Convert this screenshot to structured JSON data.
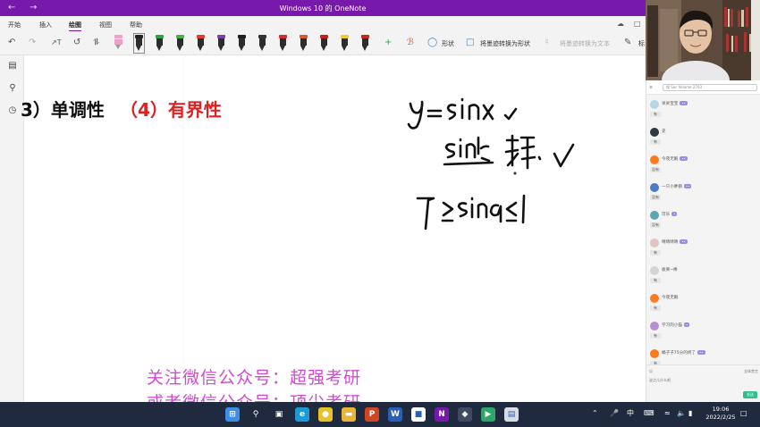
{
  "window": {
    "title": "Windows 10 的 OneNote",
    "back_icon": "back-arrow-icon",
    "forward_icon": "forward-arrow-icon"
  },
  "ribbon": {
    "tabs": [
      {
        "label": "开始",
        "active": false
      },
      {
        "label": "插入",
        "active": false
      },
      {
        "label": "绘图",
        "active": true
      },
      {
        "label": "视图",
        "active": false
      },
      {
        "label": "帮助",
        "active": false
      }
    ]
  },
  "toolbar": {
    "shapes_label": "形状",
    "ink_to_shape_label": "将墨迹转换为形状",
    "ink_to_text_label": "将墨迹转换为文本",
    "ruler_label": "标",
    "pen_colors": [
      "#f0a0c8",
      "#222222",
      "#2fa14b",
      "#47b347",
      "#e03b2f",
      "#7d3fb0",
      "#1f1f1f",
      "#333333",
      "#d42f2f",
      "#e0572e",
      "#c82020",
      "#eecf1e",
      "#c42525"
    ]
  },
  "note": {
    "heading_part1": "3）单调性",
    "heading_part2": "（4）有界性",
    "heading_color": "#e02020",
    "watermark_line1": "关注微信公众号：超强考研",
    "watermark_line2": "或者微信公众号：顶尖考研"
  },
  "chat": {
    "search_text": "搜 Soc Volume 2703",
    "messages": [
      {
        "name": "呆呆宝宝",
        "badge": "••",
        "tag": "有",
        "color": "#b6d6e8"
      },
      {
        "name": "史",
        "badge": "",
        "tag": "有",
        "color": "#2f3c3f"
      },
      {
        "name": "今夜无眠",
        "badge": "••",
        "tag": "没有",
        "color": "#ff7a1e"
      },
      {
        "name": "一只小胖鹅",
        "badge": "••",
        "tag": "没有",
        "color": "#4b7bc8"
      },
      {
        "name": "可乐",
        "badge": "•",
        "tag": "没有",
        "color": "#5aa8b4"
      },
      {
        "name": "晴晴晴晴",
        "badge": "••",
        "tag": "有",
        "color": "#e2c4c0"
      },
      {
        "name": "板栗~棒",
        "badge": "",
        "tag": "有",
        "color": "#d5d5d5"
      },
      {
        "name": "今夜无眠",
        "badge": "",
        "tag": "有",
        "color": "#ff7a1e"
      },
      {
        "name": "学习的小猫",
        "badge": "•",
        "tag": "有",
        "color": "#b88fd0"
      },
      {
        "name": "橘子子75分的终了",
        "badge": "••",
        "tag": "有",
        "color": "#ff7a1e"
      }
    ],
    "footer_hint": "说点儿什么吧",
    "footer_right": "全体禁言",
    "send_label": "发送"
  },
  "taskbar": {
    "apps": [
      {
        "name": "start-icon",
        "glyph": "⊞",
        "bg": "#3d8ee8"
      },
      {
        "name": "search-icon",
        "glyph": "⚲",
        "bg": "transparent"
      },
      {
        "name": "taskview-icon",
        "glyph": "▣",
        "bg": "transparent"
      },
      {
        "name": "edge-icon",
        "glyph": "e",
        "bg": "#1c9ad6"
      },
      {
        "name": "chrome-icon",
        "glyph": "●",
        "bg": "#e8c22a"
      },
      {
        "name": "explorer-icon",
        "glyph": "▬",
        "bg": "#e8b43a"
      },
      {
        "name": "powerpoint-icon",
        "glyph": "P",
        "bg": "#d04623"
      },
      {
        "name": "word-icon",
        "glyph": "W",
        "bg": "#2b5fb4"
      },
      {
        "name": "whiteboard-icon",
        "glyph": "■",
        "bg": "#ffffff"
      },
      {
        "name": "onenote-icon",
        "glyph": "N",
        "bg": "#7719aa"
      },
      {
        "name": "app-icon",
        "glyph": "◆",
        "bg": "#3f4b63"
      },
      {
        "name": "app2-icon",
        "glyph": "▶",
        "bg": "#2fa56a"
      },
      {
        "name": "app3-icon",
        "glyph": "▤",
        "bg": "#d8dce4"
      }
    ],
    "tray_lang": "中",
    "time": "19:06",
    "date": "2022/2/25"
  }
}
